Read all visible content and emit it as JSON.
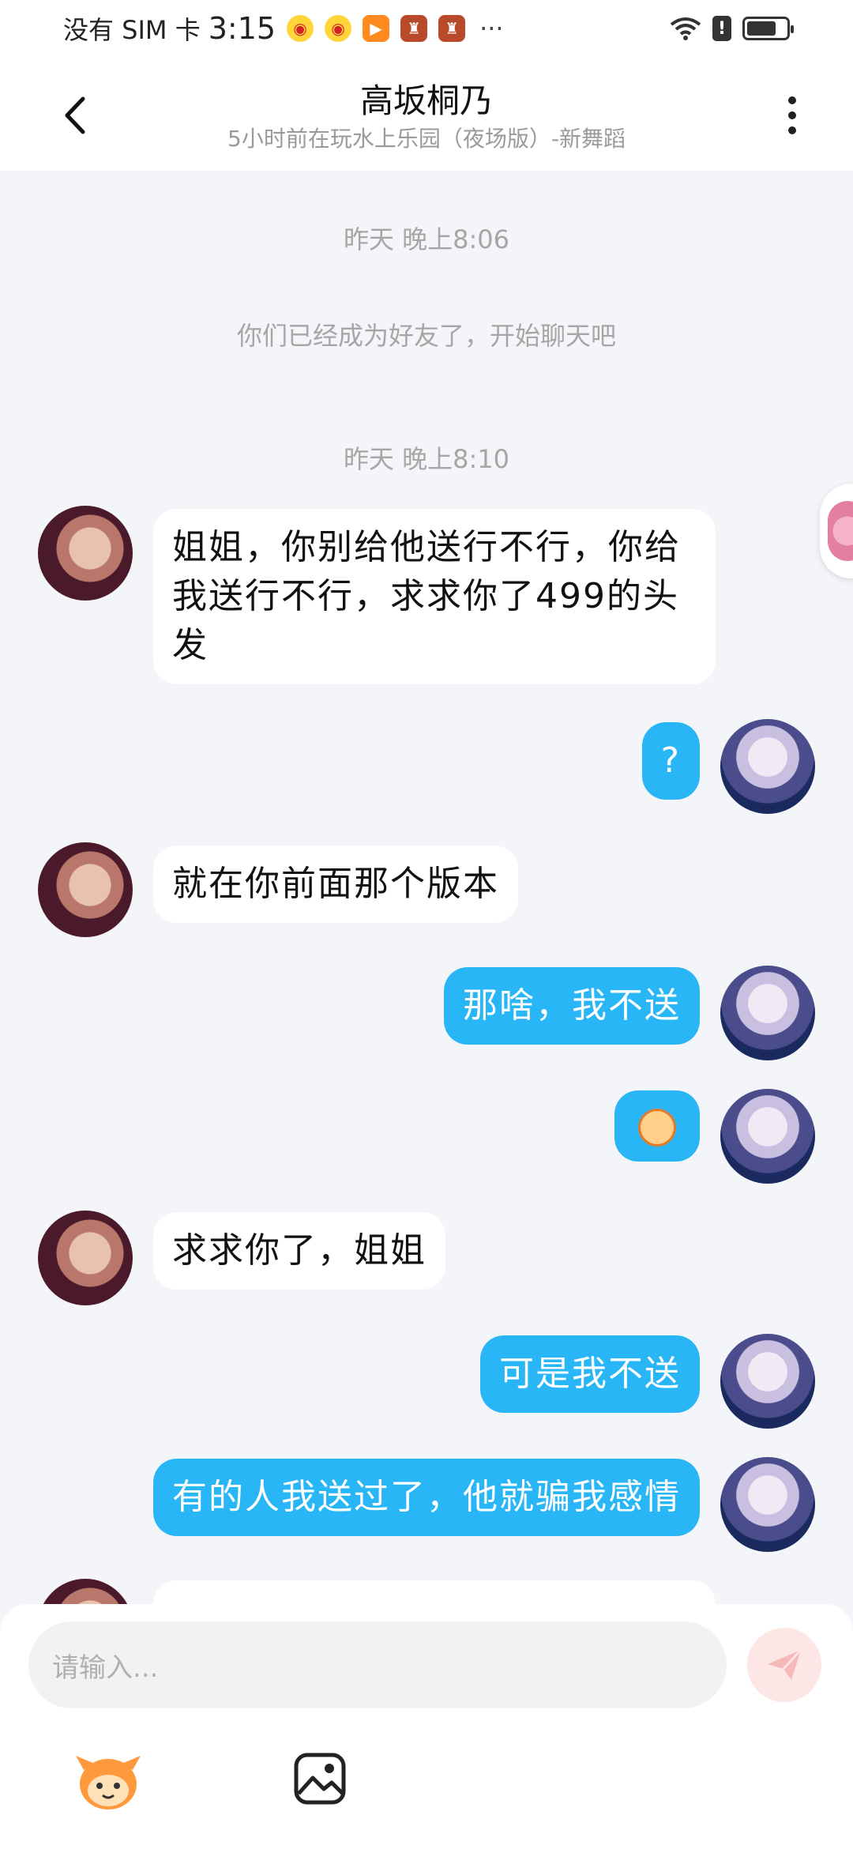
{
  "status_bar": {
    "carrier": "没有 SIM 卡",
    "time": "3:15",
    "dots": "···"
  },
  "header": {
    "title": "高坂桐乃",
    "subtitle": "5小时前在玩水上乐园（夜场版）-新舞蹈"
  },
  "chat": {
    "time_1": "昨天 晚上8:06",
    "system_message": "你们已经成为好友了，开始聊天吧",
    "time_2": "昨天 晚上8:10",
    "messages": [
      {
        "from": "her",
        "text": "姐姐，你别给他送行不行，你给我送行不行，求求你了499的头发"
      },
      {
        "from": "me",
        "text": "?"
      },
      {
        "from": "her",
        "text": "就在你前面那个版本"
      },
      {
        "from": "me",
        "text": "那啥，我不送"
      },
      {
        "from": "me",
        "sticker": "laughing-face-emoji"
      },
      {
        "from": "her",
        "text": "求求你了，姐姐"
      },
      {
        "from": "me",
        "text": "可是我不送"
      },
      {
        "from": "me",
        "text": "有的人我送过了，他就骗我感情"
      }
    ]
  },
  "input": {
    "placeholder": "请输入..."
  },
  "colors": {
    "outgoing_bubble": "#29b6f6",
    "incoming_bubble": "#ffffff",
    "chat_background": "#f3f5f8"
  }
}
